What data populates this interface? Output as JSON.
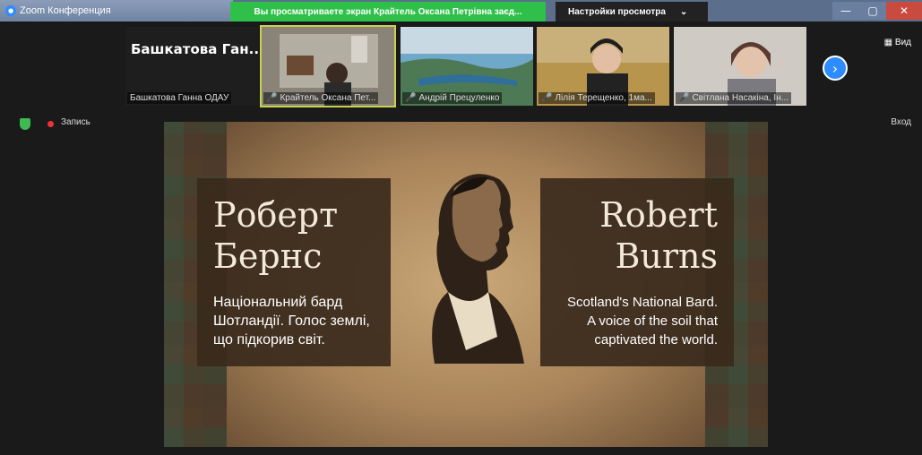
{
  "titlebar": {
    "app_title": "Zoom Конференция",
    "share_banner": "Вы просматриваете экран Крайтель Оксана Петрівна заєд...",
    "view_settings": "Настройки просмотра",
    "view_settings_chevron": "⌄",
    "minimize": "—",
    "maximize": "▢",
    "close": "✕"
  },
  "participants": {
    "self_name_big": "Башкатова Ган...",
    "self_label": "Башкатова Ганна ОДАУ",
    "tiles": [
      {
        "label": "Крайтель Оксана Пет..."
      },
      {
        "label": "Андрій Прецуленко"
      },
      {
        "label": "Лілія Терещенко, 1ма..."
      },
      {
        "label": "Світлана Насакіна, Ін..."
      }
    ],
    "next_icon": "›",
    "view_label": "Вид"
  },
  "status": {
    "record_label": "Запись",
    "enter_label": "Вход"
  },
  "slide": {
    "name_ua_line1": "Роберт",
    "name_ua_line2": "Бернс",
    "desc_ua_line1": "Національний бард",
    "desc_ua_line2": "Шотландії. Голос землі,",
    "desc_ua_line3": "що підкорив світ.",
    "name_en_line1": "Robert",
    "name_en_line2": "Burns",
    "desc_en_line1": "Scotland's National Bard.",
    "desc_en_line2": "A voice of the soil that",
    "desc_en_line3": "captivated the world."
  },
  "colors": {
    "share_banner": "#2fc04a",
    "zoom_blue": "#2d8cff",
    "record_red": "#e33333",
    "shield_green": "#3dbb52"
  }
}
